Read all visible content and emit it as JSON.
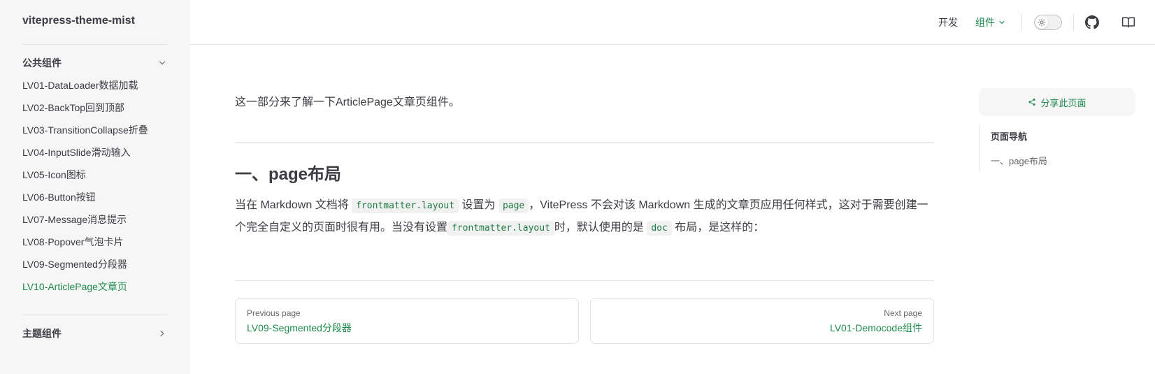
{
  "sidebar": {
    "site_title": "vitepress-theme-mist",
    "group1": {
      "title": "公共组件",
      "items": [
        "LV01-DataLoader数据加载",
        "LV02-BackTop回到顶部",
        "LV03-TransitionCollapse折叠",
        "LV04-InputSlide滑动输入",
        "LV05-Icon图标",
        "LV06-Button按钮",
        "LV07-Message消息提示",
        "LV08-Popover气泡卡片",
        "LV09-Segmented分段器",
        "LV10-ArticlePage文章页"
      ],
      "active_index": 9
    },
    "group2": {
      "title": "主题组件"
    }
  },
  "topnav": {
    "link1": "开发",
    "link2": "组件"
  },
  "content": {
    "intro": "这一部分来了解一下ArticlePage文章页组件。",
    "heading": "一、page布局",
    "para": {
      "t1": "当在 Markdown 文档将 ",
      "c1": "frontmatter.layout",
      "t2": " 设置为 ",
      "c2": "page",
      "t3": "，VitePress 不会对该 Markdown 生成的文章页应用任何样式，这对于需要创建一个完全自定义的页面时很有用。当没有设置",
      "c3": "frontmatter.layout",
      "t4": "时，默认使用的是 ",
      "c4": "doc",
      "t5": " 布局，是这样的："
    },
    "prev": {
      "desc": "Previous page",
      "title": "LV09-Segmented分段器"
    },
    "next": {
      "desc": "Next page",
      "title": "LV01-Democode组件"
    }
  },
  "aside": {
    "share_label": "分享此页面",
    "outline_title": "页面导航",
    "outline_link": "一、page布局"
  },
  "colors": {
    "brand": "#1f8a4c",
    "sidebar_bg": "#f6f6f7",
    "text": "#3c3c43"
  }
}
